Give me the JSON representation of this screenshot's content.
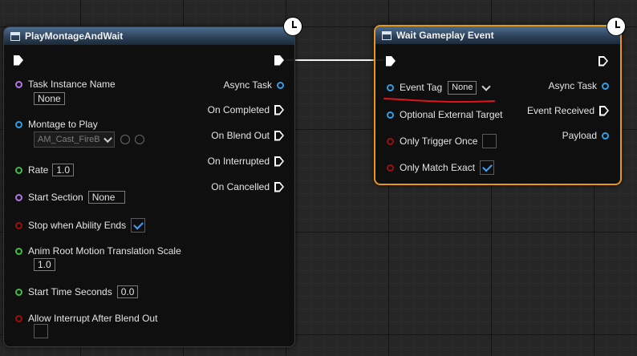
{
  "colors": {
    "pin_object": "#2e9fe6",
    "pin_struct": "#b377e8",
    "pin_float": "#3fbe44",
    "pin_bool": "#9a0f0f",
    "selection_border": "#e89518",
    "annotation": "#e0141a"
  },
  "icons": {
    "header": "function-icon",
    "latent": "clock-icon",
    "browse": "arrow-left-icon",
    "find": "search-icon"
  },
  "play_montage": {
    "title": "PlayMontageAndWait",
    "inputs": {
      "task_instance_name": {
        "label": "Task Instance Name",
        "value": "None"
      },
      "montage_to_play": {
        "label": "Montage to Play",
        "value": "AM_Cast_FireB"
      },
      "rate": {
        "label": "Rate",
        "value": "1.0"
      },
      "start_section": {
        "label": "Start Section",
        "value": "None"
      },
      "stop_when_ability_ends": {
        "label": "Stop when Ability Ends",
        "checked": true
      },
      "anim_root_motion": {
        "label": "Anim Root Motion Translation Scale",
        "value": "1.0"
      },
      "start_time_seconds": {
        "label": "Start Time Seconds",
        "value": "0.0"
      },
      "allow_interrupt": {
        "label": "Allow Interrupt After Blend Out",
        "checked": false
      }
    },
    "outputs": {
      "async_task": "Async Task",
      "on_completed": "On Completed",
      "on_blend_out": "On Blend Out",
      "on_interrupted": "On Interrupted",
      "on_cancelled": "On Cancelled"
    }
  },
  "wait_event": {
    "title": "Wait Gameplay Event",
    "inputs": {
      "event_tag": {
        "label": "Event Tag",
        "value": "None"
      },
      "optional_external_target": {
        "label": "Optional External Target"
      },
      "only_trigger_once": {
        "label": "Only Trigger Once",
        "checked": false
      },
      "only_match_exact": {
        "label": "Only Match Exact",
        "checked": true
      }
    },
    "outputs": {
      "async_task": "Async Task",
      "event_received": "Event Received",
      "payload": "Payload"
    }
  }
}
